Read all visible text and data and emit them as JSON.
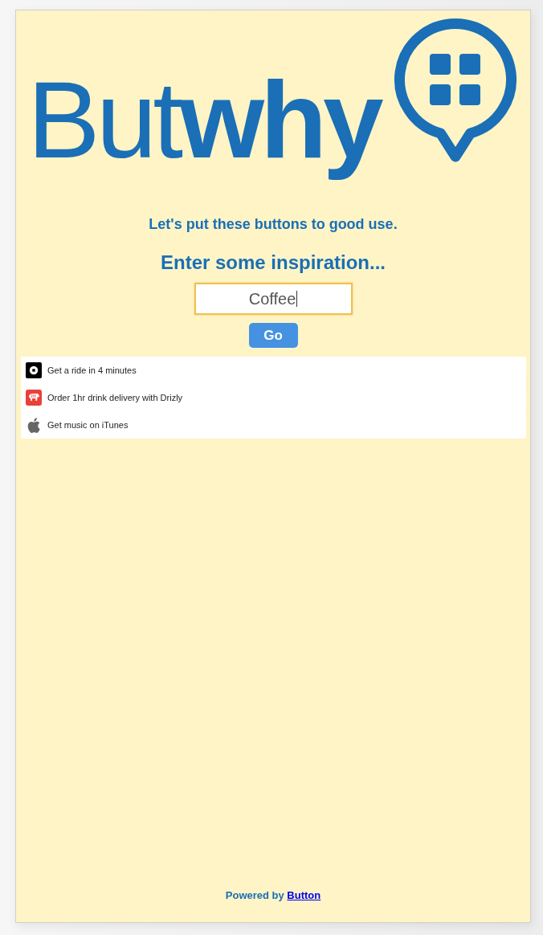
{
  "logo": {
    "wordmark": "But**why**"
  },
  "tagline": "Let's put these buttons to good use.",
  "prompt": "Enter some inspiration...",
  "search": {
    "value": "Coffee",
    "focused": true
  },
  "go_button": "Go",
  "results": [
    {
      "kind": "ride",
      "text": "Get a ride in 4 minutes"
    },
    {
      "kind": "drinks",
      "text": "Order 1hr drink delivery with Drizly"
    },
    {
      "kind": "music",
      "text": "Get music on iTunes"
    }
  ],
  "footer": {
    "text": "Powered by",
    "link": "Button"
  }
}
